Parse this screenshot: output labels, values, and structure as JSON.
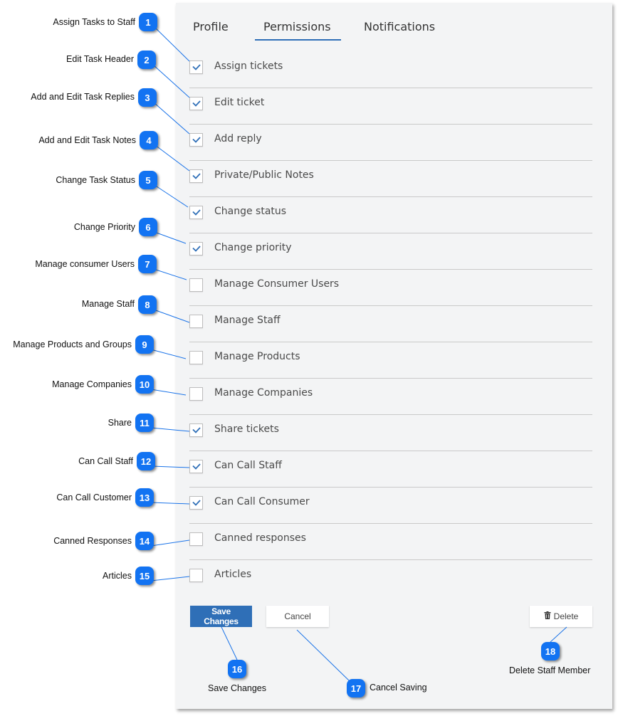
{
  "tabs": [
    {
      "label": "Profile",
      "active": false
    },
    {
      "label": "Permissions",
      "active": true
    },
    {
      "label": "Notifications",
      "active": false
    }
  ],
  "permissions": [
    {
      "label": "Assign tickets",
      "checked": true
    },
    {
      "label": "Edit ticket",
      "checked": true
    },
    {
      "label": "Add reply",
      "checked": true
    },
    {
      "label": "Private/Public Notes",
      "checked": true
    },
    {
      "label": "Change status",
      "checked": true
    },
    {
      "label": "Change priority",
      "checked": true
    },
    {
      "label": "Manage Consumer Users",
      "checked": false
    },
    {
      "label": "Manage Staff",
      "checked": false
    },
    {
      "label": "Manage Products",
      "checked": false
    },
    {
      "label": "Manage Companies",
      "checked": false
    },
    {
      "label": "Share tickets",
      "checked": true
    },
    {
      "label": "Can Call Staff",
      "checked": true
    },
    {
      "label": "Can Call Consumer",
      "checked": true
    },
    {
      "label": "Canned responses",
      "checked": false
    },
    {
      "label": "Articles",
      "checked": false
    }
  ],
  "buttons": {
    "save": "Save Changes",
    "cancel": "Cancel",
    "delete": "Delete",
    "delete_icon": "trash-icon"
  },
  "callouts": [
    {
      "number": "1",
      "label": "Assign Tasks to Staff"
    },
    {
      "number": "2",
      "label": "Edit Task Header"
    },
    {
      "number": "3",
      "label": "Add and Edit Task Replies"
    },
    {
      "number": "4",
      "label": "Add and Edit Task Notes"
    },
    {
      "number": "5",
      "label": "Change Task Status"
    },
    {
      "number": "6",
      "label": "Change Priority"
    },
    {
      "number": "7",
      "label": "Manage consumer Users"
    },
    {
      "number": "8",
      "label": "Manage Staff"
    },
    {
      "number": "9",
      "label": "Manage Products and Groups"
    },
    {
      "number": "10",
      "label": "Manage Companies"
    },
    {
      "number": "11",
      "label": "Share"
    },
    {
      "number": "12",
      "label": "Can Call Staff"
    },
    {
      "number": "13",
      "label": "Can Call Customer"
    },
    {
      "number": "14",
      "label": "Canned Responses"
    },
    {
      "number": "15",
      "label": "Articles"
    },
    {
      "number": "16",
      "label": "Save Changes"
    },
    {
      "number": "17",
      "label": "Cancel Saving"
    },
    {
      "number": "18",
      "label": "Delete Staff Member"
    }
  ],
  "colors": {
    "accent": "#2f6fb7",
    "badge": "#1273f2",
    "connector": "#1a73e8",
    "panel_bg": "#f3f4f5"
  }
}
